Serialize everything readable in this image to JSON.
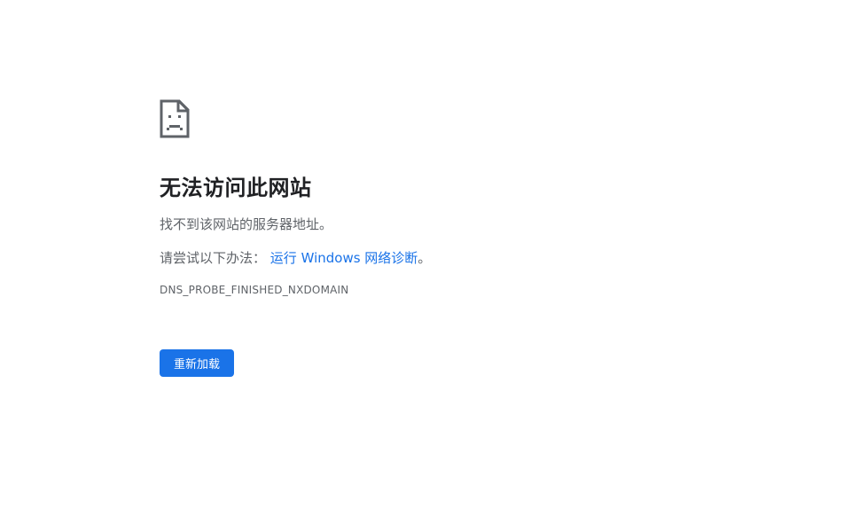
{
  "error": {
    "icon": "sad-page-icon",
    "title": "无法访问此网站",
    "description": "找不到该网站的服务器地址。",
    "hint_prefix": "请尝试以下办法：",
    "hint_link": "运行 Windows 网络诊断",
    "hint_suffix": "。",
    "code": "DNS_PROBE_FINISHED_NXDOMAIN",
    "reload_label": "重新加载"
  },
  "colors": {
    "accent": "#1a73e8",
    "text_primary": "#202124",
    "text_secondary": "#5f6368",
    "background": "#ffffff"
  }
}
